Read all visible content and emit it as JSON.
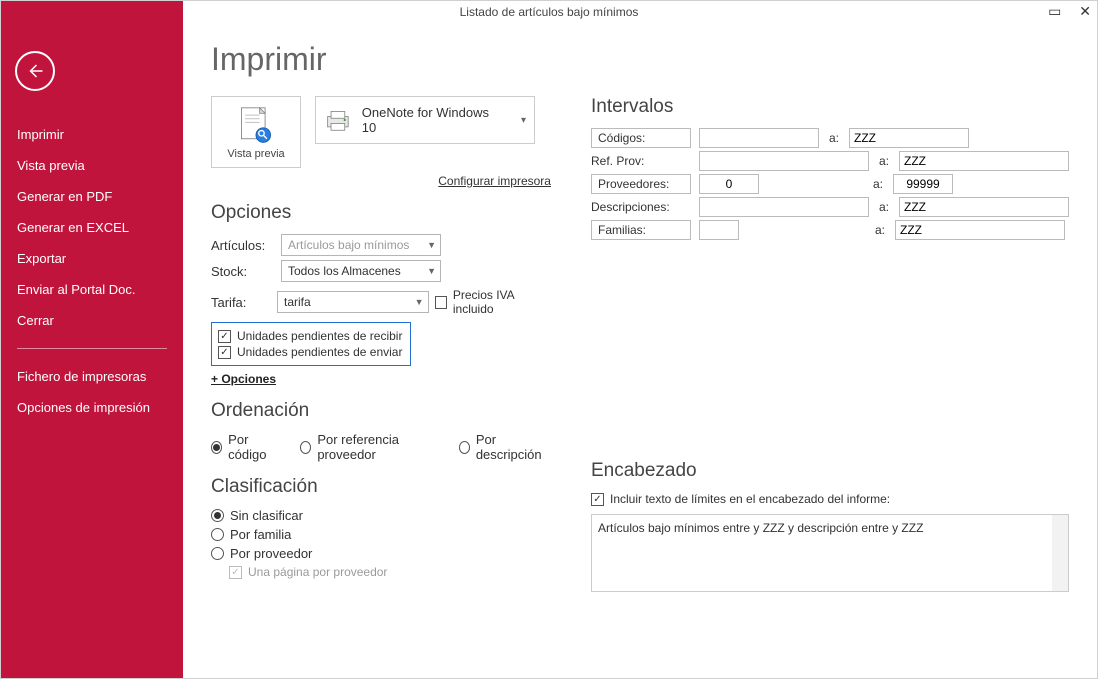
{
  "title": "Listado de artículos bajo mínimos",
  "sidebar": {
    "items": [
      "Imprimir",
      "Vista previa",
      "Generar en PDF",
      "Generar en EXCEL",
      "Exportar",
      "Enviar al Portal Doc.",
      "Cerrar"
    ],
    "settings": [
      "Fichero de impresoras",
      "Opciones de impresión"
    ]
  },
  "header": "Imprimir",
  "preview": {
    "label": "Vista previa"
  },
  "printer": {
    "name": "OneNote for Windows 10",
    "configure": "Configurar impresora"
  },
  "options": {
    "heading": "Opciones",
    "articulos_lbl": "Artículos:",
    "articulos_val": "Artículos bajo mínimos",
    "stock_lbl": "Stock:",
    "stock_val": "Todos los Almacenes",
    "tarifa_lbl": "Tarifa:",
    "tarifa_val": "tarifa",
    "precios_iva": "Precios IVA incluido",
    "pend_recibir": "Unidades pendientes de recibir",
    "pend_enviar": "Unidades pendientes de enviar",
    "mas": "+ Opciones"
  },
  "ordenacion": {
    "heading": "Ordenación",
    "por_codigo": "Por código",
    "por_ref": "Por referencia proveedor",
    "por_desc": "Por descripción"
  },
  "clasificacion": {
    "heading": "Clasificación",
    "sin": "Sin clasificar",
    "familia": "Por familia",
    "proveedor": "Por proveedor",
    "pagina": "Una página por proveedor"
  },
  "intervalos": {
    "heading": "Intervalos",
    "codigos": "Códigos:",
    "ref_prov": "Ref. Prov:",
    "proveedores": "Proveedores:",
    "descripciones": "Descripciones:",
    "familias": "Familias:",
    "a": "a:",
    "zzz": "ZZZ",
    "prov_from": "0",
    "prov_to": "99999"
  },
  "encabezado": {
    "heading": "Encabezado",
    "incluir": "Incluir texto de límites en el encabezado del informe:",
    "text": "Artículos bajo mínimos entre  y ZZZ y descripción entre  y ZZZ"
  }
}
